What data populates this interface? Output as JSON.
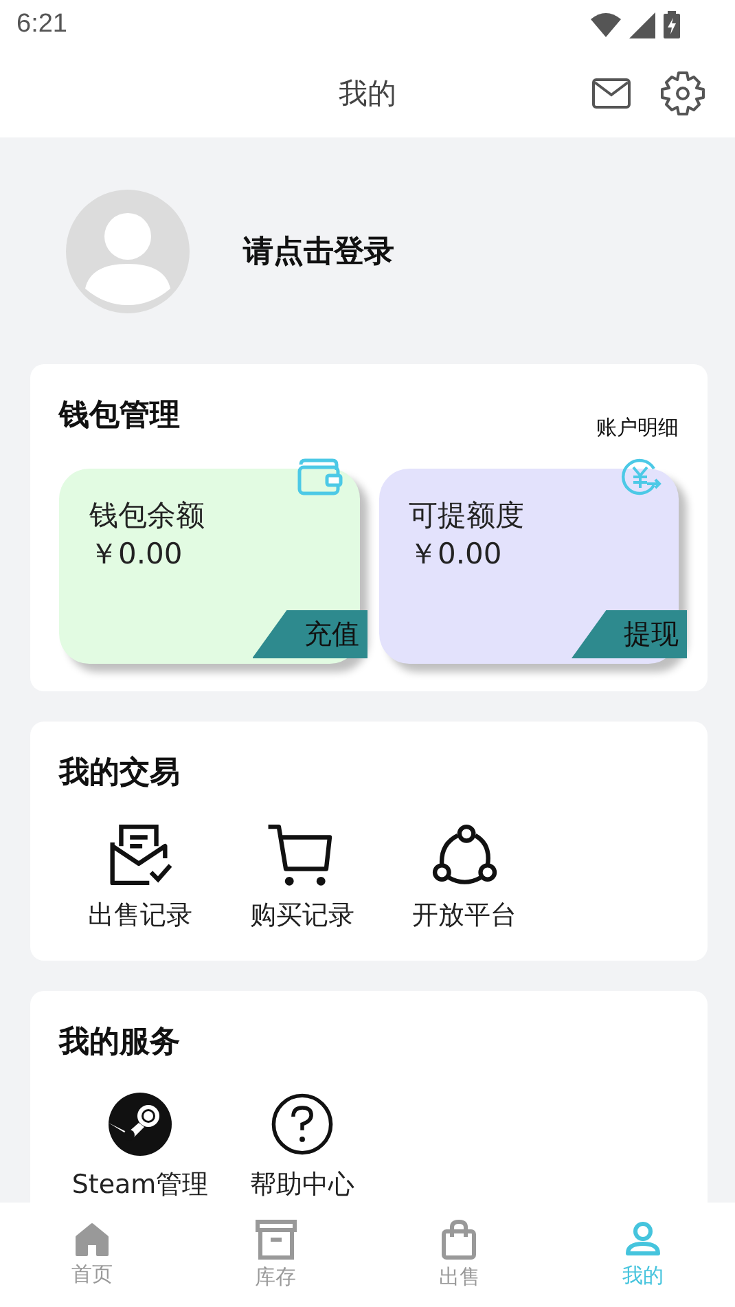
{
  "status_bar": {
    "time": "6:21"
  },
  "header": {
    "title": "我的"
  },
  "profile": {
    "login_text": "请点击登录"
  },
  "wallet": {
    "title": "钱包管理",
    "link": "账户明细",
    "cards": [
      {
        "kind": "wallet",
        "label": "钱包余额",
        "amount": "￥0.00",
        "action": "充值",
        "color": "#e2fbe2"
      },
      {
        "kind": "withdraw",
        "label": "可提额度",
        "amount": "￥0.00",
        "action": "提现",
        "color": "#e3e2fc"
      }
    ]
  },
  "trades": {
    "title": "我的交易",
    "items": [
      {
        "kind": "sales",
        "label": "出售记录"
      },
      {
        "kind": "cart",
        "label": "购买记录"
      },
      {
        "kind": "platform",
        "label": "开放平台"
      }
    ]
  },
  "services": {
    "title": "我的服务",
    "items": [
      {
        "kind": "steam",
        "label": "Steam管理"
      },
      {
        "kind": "help",
        "label": "帮助中心"
      }
    ]
  },
  "tabs": [
    {
      "kind": "home",
      "label": "首页",
      "selected": false
    },
    {
      "kind": "inventory",
      "label": "库存",
      "selected": false
    },
    {
      "kind": "sell",
      "label": "出售",
      "selected": false
    },
    {
      "kind": "me",
      "label": "我的",
      "selected": true
    }
  ]
}
